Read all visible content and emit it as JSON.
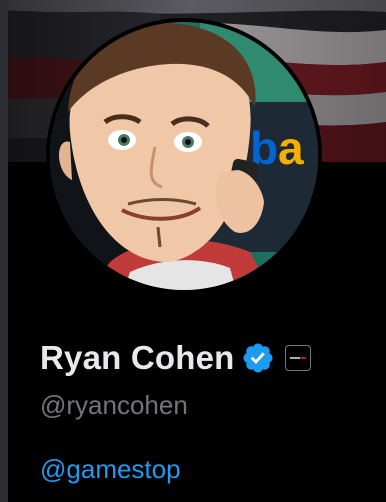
{
  "profile": {
    "display_name": "Ryan Cohen",
    "handle": "@ryancohen",
    "bio_link": "@gamestop",
    "verified_icon": "verified-badge-icon",
    "affiliate_icon": "gamestop-affiliate-icon",
    "avatar_sign_text": "eba"
  },
  "colors": {
    "background": "#000000",
    "name": "#e7e9ea",
    "handle": "#71767b",
    "link": "#1d9bf0",
    "verified": "#1d9bf0"
  }
}
